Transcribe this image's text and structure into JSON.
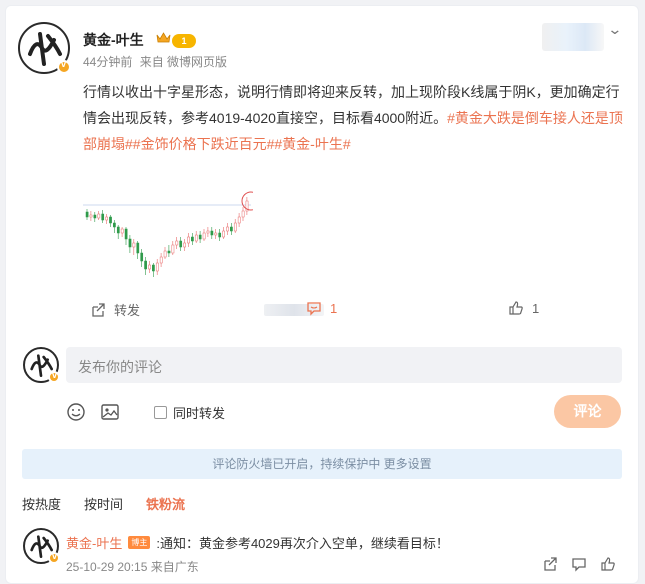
{
  "post": {
    "author": "黄金-叶生",
    "level_badge": "1",
    "time": "44分钟前",
    "source": "来自 微博网页版",
    "text_plain": "行情以收出十字星形态，说明行情即将迎来反转，加上现阶段K线属于阴K，更加确定行情会出现反转，参考4019-4020直接空，目标看4000附近。",
    "tags": [
      "#黄金大跌是倒车接人还是顶部崩塌#",
      "#金饰价格下跌近百元#",
      "#黄金-叶生#"
    ]
  },
  "actions": {
    "repost_label": "转发",
    "comment_count": "1",
    "like_count": "1"
  },
  "composer": {
    "placeholder": "发布你的评论",
    "repost_checkbox_label": "同时转发",
    "submit_label": "评论"
  },
  "notice": "评论防火墙已开启，持续保护中 更多设置",
  "sort_tabs": [
    {
      "label": "按热度"
    },
    {
      "label": "按时间"
    },
    {
      "label": "铁粉流"
    }
  ],
  "comment": {
    "author": "黄金-叶生",
    "badge": "博主",
    "text": ":通知：黄金参考4029再次介入空单，继续看目标！",
    "time": "25-10-29 20:15",
    "location": "来自广东"
  },
  "colors": {
    "accent": "#eb7350",
    "candle_up": "#e86a6a",
    "candle_down": "#2e9a4a",
    "submit_button": "#fbc7a4",
    "notice_bg": "#e6f1fb"
  },
  "icons": [
    "crown-icon",
    "repost-icon",
    "comment-icon",
    "like-icon",
    "emoji-icon",
    "image-icon",
    "share-icon",
    "reply-icon",
    "chevron-down-icon",
    "verified-icon"
  ]
}
